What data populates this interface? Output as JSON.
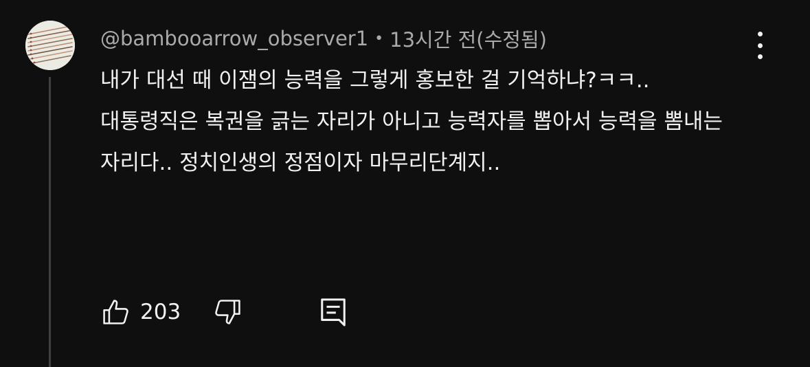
{
  "comment": {
    "author": "@bambooarrow_observer1",
    "separator": "•",
    "timestamp": "13시간 전(수정됨)",
    "paragraphs": [
      "내가 대선 때 이잼의 능력을 그렇게 홍보한 걸 기억하냐?ㅋㅋ..",
      "대통령직은 복권을 긁는 자리가 아니고 능력자를 뽑아서 능력을 뽐내는 자리다.. 정치인생의 정점이자 마무리단계지.."
    ],
    "like_count": "203"
  },
  "icons": {
    "avatar": "bamboo-arrows-avatar",
    "more": "vertical-ellipsis-icon",
    "like": "thumbs-up-icon",
    "dislike": "thumbs-down-icon",
    "reply": "reply-comment-icon"
  },
  "colors": {
    "background": "#0f0f0f",
    "text_primary": "#f1f1f1",
    "text_secondary": "#aaaaaa",
    "thread_line": "#3f3f3f"
  }
}
